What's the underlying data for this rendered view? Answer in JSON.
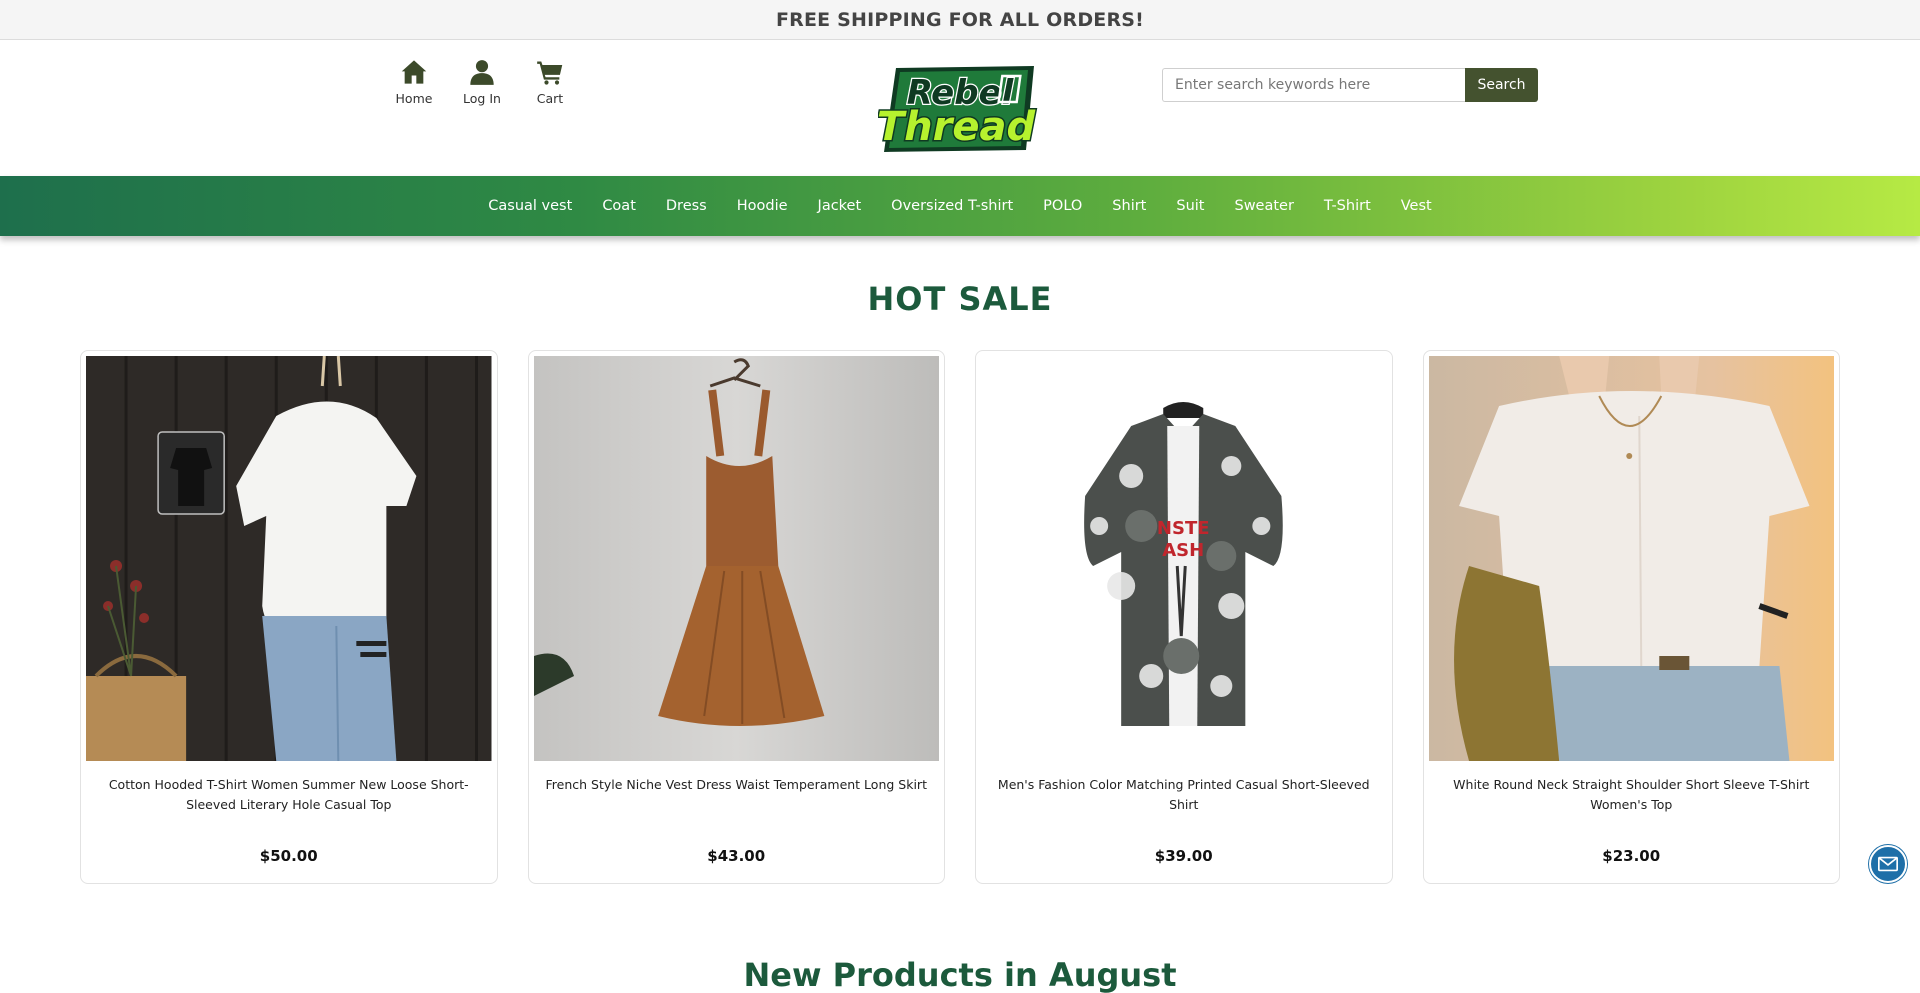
{
  "announcement": "FREE SHIPPING FOR ALL ORDERS!",
  "nav": {
    "home": "Home",
    "login": "Log In",
    "cart": "Cart"
  },
  "logo": {
    "line1": "Rebel",
    "line2": "Thread"
  },
  "search": {
    "placeholder": "Enter search keywords here",
    "button": "Search"
  },
  "categories": [
    "Casual vest",
    "Coat",
    "Dress",
    "Hoodie",
    "Jacket",
    "Oversized T-shirt",
    "POLO",
    "Shirt",
    "Suit",
    "Sweater",
    "T-Shirt",
    "Vest"
  ],
  "hot_sale": {
    "title": "HOT SALE",
    "products": [
      {
        "name": "Cotton Hooded T-Shirt Women Summer New Loose Short-Sleeved Literary Hole Casual Top",
        "price": "$50.00"
      },
      {
        "name": "French Style Niche Vest Dress Waist Temperament Long Skirt",
        "price": "$43.00"
      },
      {
        "name": "Men's Fashion Color Matching Printed Casual Short-Sleeved Shirt",
        "price": "$39.00"
      },
      {
        "name": "White Round Neck Straight Shoulder Short Sleeve T-Shirt Women's Top",
        "price": "$23.00"
      }
    ]
  },
  "new_products_title": "New Products in August",
  "icons": {
    "home": "home-icon",
    "login": "user-icon",
    "cart": "cart-icon",
    "contact": "mail-icon"
  },
  "colors": {
    "brand_green": "#1c5a3c",
    "search_button": "#44522f",
    "mail_button": "#1e6fa8"
  }
}
